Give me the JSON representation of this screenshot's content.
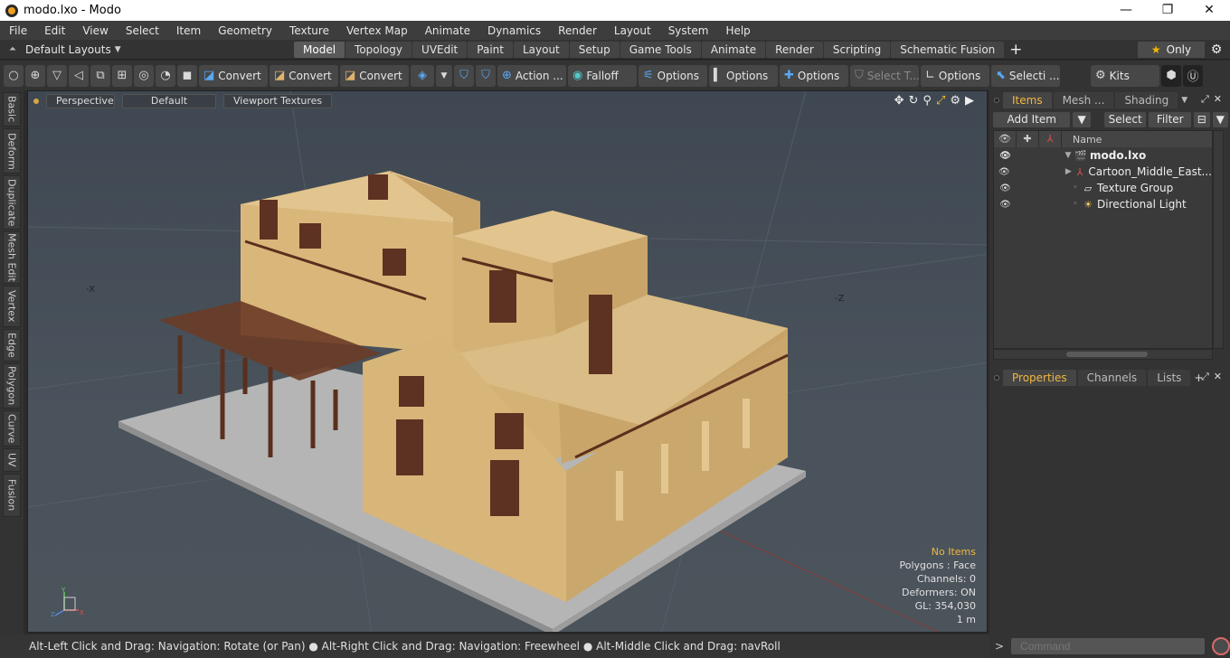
{
  "window": {
    "title": "modo.lxo - Modo",
    "minimize": "—",
    "maximize": "❐",
    "close": "✕"
  },
  "menu": [
    "File",
    "Edit",
    "View",
    "Select",
    "Item",
    "Geometry",
    "Texture",
    "Vertex Map",
    "Animate",
    "Dynamics",
    "Render",
    "Layout",
    "System",
    "Help"
  ],
  "layouts": {
    "label": "Default Layouts",
    "caret": "▼",
    "up": "⏶"
  },
  "mode_tabs": [
    {
      "label": "Model",
      "active": true
    },
    {
      "label": "Topology"
    },
    {
      "label": "UVEdit"
    },
    {
      "label": "Paint"
    },
    {
      "label": "Layout"
    },
    {
      "label": "Setup"
    },
    {
      "label": "Game Tools"
    },
    {
      "label": "Animate"
    },
    {
      "label": "Render"
    },
    {
      "label": "Scripting"
    },
    {
      "label": "Schematic Fusion"
    }
  ],
  "add_tab": "+",
  "only": {
    "star": "★",
    "label": "Only"
  },
  "settings_icon": "⚙",
  "toolbar": {
    "select_modes": [
      "○",
      "⊕",
      "▽",
      "◁",
      "⧉",
      "⊞",
      "◎",
      "◔",
      "◼"
    ],
    "convert1": "Convert",
    "convert2": "Convert",
    "convert3": "Convert",
    "action": "Action ...",
    "falloff": "Falloff",
    "options1": "Options",
    "options2": "Options",
    "options3": "Options",
    "select_t": "Select T...",
    "options4": "Options",
    "selecti": "Selecti ...",
    "kits": "Kits"
  },
  "left_tabs": [
    "Basic",
    "Deform",
    "Duplicate",
    "Mesh Edit",
    "Vertex",
    "Edge",
    "Polygon",
    "Curve",
    "UV",
    "Fusion"
  ],
  "viewport": {
    "view": "Perspective",
    "shading": "Default",
    "textures": "Viewport Textures",
    "icons": [
      "✥",
      "↻",
      "⚲",
      "⤢",
      "⚙",
      "▶"
    ]
  },
  "stats": {
    "no_items": "No Items",
    "polygons": "Polygons : Face",
    "channels": "Channels: 0",
    "deformers": "Deformers: ON",
    "gl": "GL: 354,030",
    "scale": "1 m"
  },
  "status": "Alt-Left Click and Drag: Navigation: Rotate (or Pan) ● Alt-Right Click and Drag: Navigation: Freewheel ● Alt-Middle Click and Drag: navRoll",
  "panel_top": {
    "tabs": [
      "Items",
      "Mesh ...",
      "Shading"
    ],
    "add_item": "Add Item",
    "select": "Select",
    "filter": "Filter",
    "name_col": "Name",
    "items": [
      {
        "name": "modo.lxo",
        "icon": "🎬",
        "tree": "▼"
      },
      {
        "name": "Cartoon_Middle_East...",
        "icon": "⅄",
        "tree": "▶"
      },
      {
        "name": "Texture Group",
        "icon": "▱",
        "tree": "◦"
      },
      {
        "name": "Directional Light",
        "icon": "☀",
        "tree": "◦"
      }
    ]
  },
  "panel_bottom": {
    "tabs": [
      "Properties",
      "Channels",
      "Lists"
    ]
  },
  "command": {
    "placeholder": "Command"
  },
  "colors": {
    "accent": "#f0b840",
    "wall": "#d9b77a",
    "ground": "#b9b9b9",
    "wood": "#6a3b26"
  }
}
